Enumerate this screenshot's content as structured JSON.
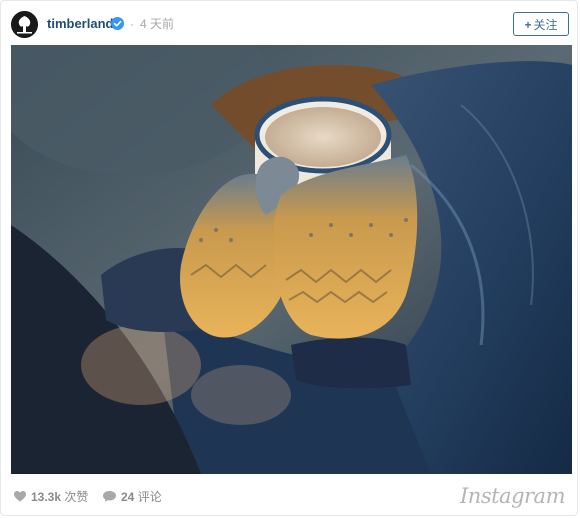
{
  "post": {
    "username": "timberland",
    "verified": true,
    "separator": "·",
    "time_ago": "4 天前",
    "follow_label": "关注",
    "follow_plus": "+"
  },
  "photo": {
    "icon": "photo-hands-mug-icon"
  },
  "stats": {
    "likes_count": "13.3k",
    "likes_label": "次赞",
    "comments_count": "24",
    "comments_label": "评论"
  },
  "brand": {
    "name": "Instagram"
  },
  "colors": {
    "username": "#1f4e79",
    "follow_accent": "#3f729b",
    "verified_badge": "#3897f0",
    "meta_text": "#8a8a8a"
  }
}
